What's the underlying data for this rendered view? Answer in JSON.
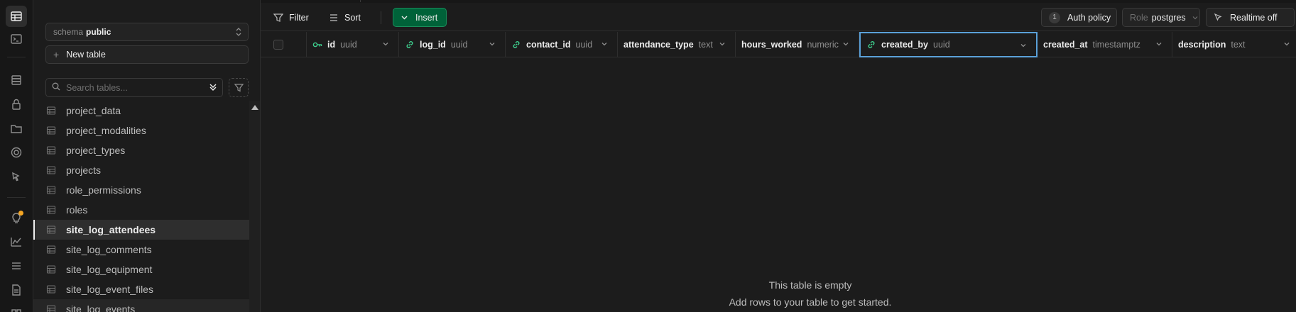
{
  "schema": {
    "prefix": "schema",
    "value": "public"
  },
  "sidebar": {
    "new_table": "New table",
    "search_placeholder": "Search tables...",
    "tables": [
      {
        "name": "project_data"
      },
      {
        "name": "project_modalities"
      },
      {
        "name": "project_types"
      },
      {
        "name": "projects"
      },
      {
        "name": "role_permissions"
      },
      {
        "name": "roles"
      },
      {
        "name": "site_log_attendees",
        "active": true
      },
      {
        "name": "site_log_comments"
      },
      {
        "name": "site_log_equipment"
      },
      {
        "name": "site_log_event_files"
      },
      {
        "name": "site_log_events"
      }
    ]
  },
  "toolbar": {
    "filter": "Filter",
    "sort": "Sort",
    "insert": "Insert",
    "auth_count": "1",
    "auth_policy": "Auth policy",
    "role_label": "Role",
    "role_value": "postgres",
    "realtime": "Realtime off"
  },
  "columns": [
    {
      "name": "id",
      "type": "uuid",
      "icon": "key-icon"
    },
    {
      "name": "log_id",
      "type": "uuid",
      "icon": "link-icon"
    },
    {
      "name": "contact_id",
      "type": "uuid",
      "icon": "link-icon"
    },
    {
      "name": "attendance_type",
      "type": "text"
    },
    {
      "name": "hours_worked",
      "type": "numeric"
    },
    {
      "name": "created_by",
      "type": "uuid",
      "icon": "link-icon",
      "selected": true
    },
    {
      "name": "created_at",
      "type": "timestamptz"
    },
    {
      "name": "description",
      "type": "text"
    }
  ],
  "empty": {
    "title": "This table is empty",
    "subtitle": "Add rows to your table to get started."
  },
  "colors": {
    "accent": "#3ecf8e",
    "insert_bg": "#006239",
    "selected_border": "#5aa0d8"
  }
}
